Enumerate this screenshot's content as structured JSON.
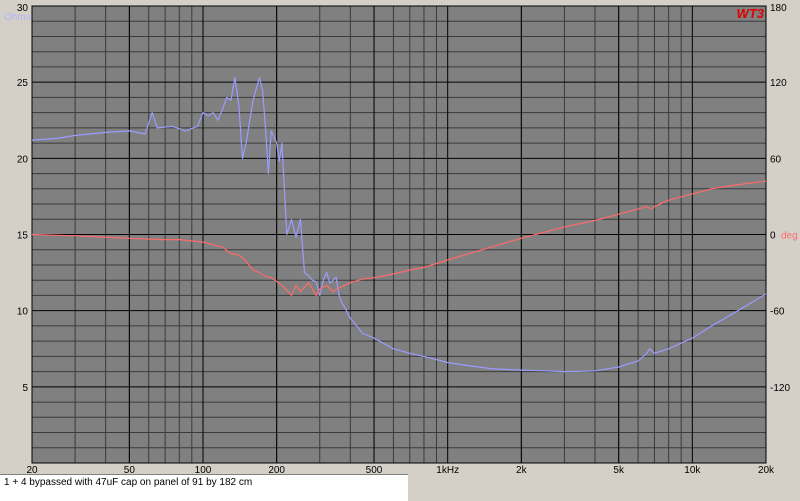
{
  "chart_data": {
    "type": "line",
    "logo": "WT3",
    "caption": "1 + 4 bypassed with 47uF cap on panel of 91 by 182 cm",
    "x_scale": "log",
    "xlim": [
      20,
      20000
    ],
    "ylim_left": [
      0,
      30
    ],
    "ylim_right": [
      -180,
      180
    ],
    "grid": true,
    "colors": {
      "background": "#808080",
      "major_grid": "#000000",
      "minor_grid": "#3a3a3a",
      "impedance": "#9b9bff",
      "phase": "#ff6b6b",
      "logo": "#e00000",
      "unit_left": "#b4b4ff",
      "unit_right": "#ff6b6b"
    },
    "left_axis": {
      "unit": "Ohms",
      "ticks": [
        {
          "v": 30,
          "label": "30"
        },
        {
          "v": 25,
          "label": "25"
        },
        {
          "v": 20,
          "label": "20"
        },
        {
          "v": 15,
          "label": "15"
        },
        {
          "v": 10,
          "label": "10"
        },
        {
          "v": 5,
          "label": "5"
        }
      ]
    },
    "right_axis": {
      "unit": "deg",
      "ticks": [
        {
          "v": 180,
          "label": "180"
        },
        {
          "v": 120,
          "label": "120"
        },
        {
          "v": 60,
          "label": "60"
        },
        {
          "v": 0,
          "label": "0"
        },
        {
          "v": -60,
          "label": "-60"
        },
        {
          "v": -120,
          "label": "-120"
        }
      ]
    },
    "x_ticks": [
      {
        "v": 20,
        "label": "20"
      },
      {
        "v": 50,
        "label": "50"
      },
      {
        "v": 100,
        "label": "100"
      },
      {
        "v": 200,
        "label": "200"
      },
      {
        "v": 500,
        "label": "500"
      },
      {
        "v": 1000,
        "label": "1kHz"
      },
      {
        "v": 2000,
        "label": "2k"
      },
      {
        "v": 5000,
        "label": "5k"
      },
      {
        "v": 10000,
        "label": "10k"
      },
      {
        "v": 20000,
        "label": "20k"
      }
    ],
    "series": [
      {
        "axis": "left",
        "x": [
          20,
          25,
          30,
          40,
          50,
          58,
          62,
          65,
          75,
          85,
          95,
          100,
          105,
          110,
          115,
          120,
          125,
          130,
          135,
          140,
          145,
          150,
          160,
          170,
          175,
          180,
          185,
          190,
          200,
          205,
          210,
          220,
          230,
          240,
          250,
          260,
          270,
          280,
          290,
          300,
          310,
          320,
          330,
          340,
          350,
          360,
          370,
          380,
          400,
          450,
          500,
          600,
          700,
          800,
          1000,
          1200,
          1500,
          2000,
          2500,
          3000,
          3500,
          4000,
          5000,
          6000,
          6500,
          6700,
          7000,
          8000,
          10000,
          12000,
          15000,
          20000
        ],
        "y": [
          21.2,
          21.3,
          21.5,
          21.7,
          21.8,
          21.6,
          23.0,
          22.0,
          22.1,
          21.8,
          22.1,
          23.0,
          22.8,
          23.0,
          22.5,
          23.2,
          24.0,
          23.8,
          25.3,
          23.5,
          20.0,
          21.0,
          23.8,
          25.3,
          24.5,
          22.0,
          19.0,
          21.8,
          21.0,
          19.8,
          21.0,
          15.0,
          16.0,
          14.8,
          16.0,
          12.5,
          12.3,
          12.0,
          11.9,
          11.0,
          12.0,
          12.5,
          11.8,
          12.0,
          12.2,
          11.0,
          10.5,
          10.2,
          9.5,
          8.5,
          8.2,
          7.5,
          7.2,
          7.0,
          6.6,
          6.4,
          6.2,
          6.1,
          6.05,
          6.0,
          6.02,
          6.05,
          6.3,
          6.7,
          7.2,
          7.5,
          7.2,
          7.5,
          8.2,
          9.0,
          9.9,
          11.1
        ]
      },
      {
        "axis": "right",
        "x": [
          20,
          30,
          50,
          70,
          80,
          100,
          120,
          130,
          140,
          150,
          160,
          170,
          180,
          190,
          200,
          210,
          220,
          230,
          240,
          250,
          270,
          280,
          290,
          300,
          320,
          340,
          360,
          400,
          450,
          500,
          600,
          700,
          800,
          1000,
          1500,
          2000,
          3000,
          4000,
          5000,
          6000,
          6500,
          6800,
          7000,
          8000,
          10000,
          12000,
          15000,
          20000
        ],
        "y": [
          0,
          -1,
          -3,
          -4,
          -4,
          -6,
          -10,
          -15,
          -16,
          -21,
          -28,
          -30,
          -33,
          -34,
          -37,
          -40,
          -44,
          -48,
          -40,
          -45,
          -38,
          -43,
          -48,
          -43,
          -40,
          -45,
          -42,
          -38,
          -35,
          -34,
          -31,
          -28,
          -26,
          -20,
          -10,
          -3,
          6,
          11,
          16,
          20,
          22,
          20,
          22,
          27,
          32,
          36,
          39,
          42
        ]
      }
    ]
  }
}
